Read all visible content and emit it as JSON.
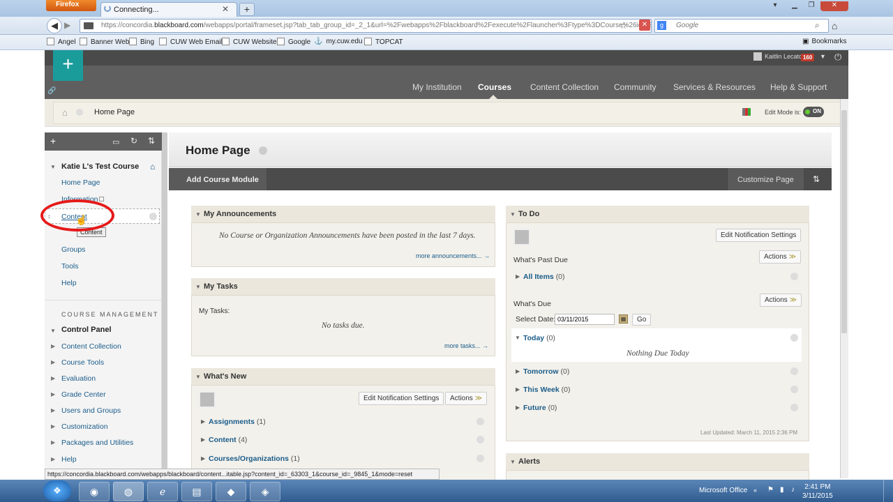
{
  "browser": {
    "app_button": "Firefox",
    "tab_title": "Connecting...",
    "url_prefix": "https://concordia.",
    "url_domain": "blackboard.com",
    "url_rest": "/webapps/portal/frameset.jsp?tab_tab_group_id=_2_1&url=%2Fwebapps%2Fblackboard%2Fexecute%2Flauncher%3Ftype%3DCourse%26id%3",
    "search_placeholder": "Google",
    "bookmarks": [
      "Angel",
      "Banner Web",
      "Bing",
      "CUW Web Email",
      "CUW Website",
      "Google",
      "my.cuw.edu",
      "TOPCAT"
    ],
    "bookmarks_menu": "Bookmarks",
    "status_url": "https://concordia.blackboard.com/webapps/blackboard/content...itable.jsp?content_id=_63303_1&course_id=_9845_1&mode=reset"
  },
  "header": {
    "user_name": "Kaitlin Lecato",
    "notification_count": "160",
    "nav": [
      "My Institution",
      "Courses",
      "Content Collection",
      "Community",
      "Services & Resources",
      "Help & Support"
    ],
    "active_nav": "Courses"
  },
  "breadcrumb": {
    "current": "Home Page",
    "edit_mode_label": "Edit Mode is:",
    "edit_mode_value": "ON"
  },
  "course_menu": {
    "course_name": "Katie L's Test Course",
    "items": [
      "Home Page",
      "Information",
      "Content",
      "Groups",
      "Tools",
      "Help"
    ],
    "tooltip": "Content",
    "management_label": "COURSE MANAGEMENT",
    "control_panel": "Control Panel",
    "control_items": [
      "Content Collection",
      "Course Tools",
      "Evaluation",
      "Grade Center",
      "Users and Groups",
      "Customization",
      "Packages and Utilities",
      "Help"
    ]
  },
  "main": {
    "title": "Home Page",
    "add_module": "Add Course Module",
    "customize": "Customize Page",
    "announcements": {
      "title": "My Announcements",
      "empty": "No Course or Organization Announcements have been posted in the last 7 days.",
      "more": "more announcements..."
    },
    "tasks": {
      "title": "My Tasks",
      "label": "My Tasks:",
      "empty": "No tasks due.",
      "more": "more tasks..."
    },
    "whats_new": {
      "title": "What's New",
      "edit_btn": "Edit Notification Settings",
      "actions_btn": "Actions",
      "items": [
        {
          "label": "Assignments",
          "count": "(1)"
        },
        {
          "label": "Content",
          "count": "(4)"
        },
        {
          "label": "Courses/Organizations",
          "count": "(1)"
        }
      ]
    },
    "todo": {
      "title": "To Do",
      "edit_btn": "Edit Notification Settings",
      "past_due_label": "What's Past Due",
      "actions_btn": "Actions",
      "all_items": "All Items",
      "all_items_count": "(0)",
      "due_label": "What's Due",
      "select_date_label": "Select Date:",
      "date_value": "03/11/2015",
      "go_btn": "Go",
      "today": "Today",
      "today_count": "(0)",
      "nothing_due": "Nothing Due Today",
      "tomorrow": "Tomorrow",
      "tomorrow_count": "(0)",
      "this_week": "This Week",
      "this_week_count": "(0)",
      "future": "Future",
      "future_count": "(0)",
      "last_updated": "Last Updated: March 11, 2015 2:36 PM"
    },
    "alerts": {
      "title": "Alerts"
    }
  },
  "taskbar": {
    "ms_office": "Microsoft Office",
    "time": "2:41 PM",
    "date": "3/11/2015"
  }
}
